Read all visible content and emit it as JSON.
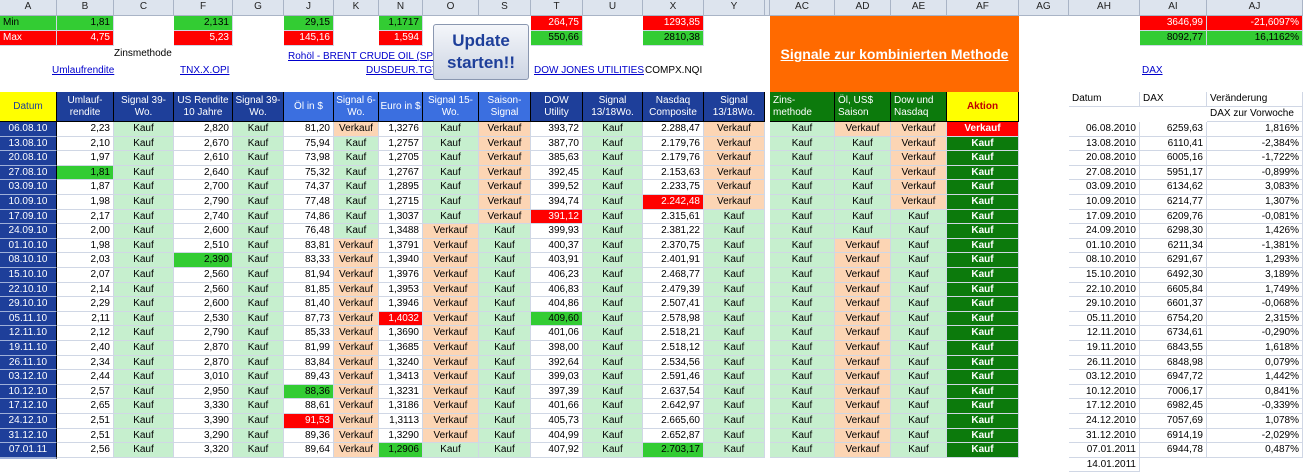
{
  "columns": [
    "A",
    "B",
    "C",
    "F",
    "G",
    "J",
    "K",
    "N",
    "O",
    "S",
    "T",
    "U",
    "X",
    "Y",
    "AC",
    "AD",
    "AE",
    "AF",
    "AG",
    "AH",
    "AI",
    "AJ"
  ],
  "top_stats": {
    "min_label": "Min",
    "max_label": "Max",
    "min": {
      "B": "1,81",
      "F": "2,131",
      "J": "29,15",
      "N": "1,1717",
      "T": "264,75",
      "X": "1293,85",
      "AI": "3646,99",
      "AJ": "-21,6097%"
    },
    "max": {
      "B": "4,75",
      "F": "5,23",
      "J": "145,16",
      "N": "1,594",
      "T": "550,66",
      "X": "2810,38",
      "AI": "8092,77",
      "AJ": "16,1162%"
    }
  },
  "labels": {
    "zinsmethode": "Zinsmethode",
    "umlaufrendite": "Umlaufrendite",
    "tnx": "TNX.X.OPI",
    "rohoel": "Rohöl - BRENT CRUDE OIL (SP",
    "dusdeur": "DUSDEUR.TGT",
    "dow": "DOW JONES UTILITIES",
    "compx": "COMPX.NQI",
    "dax": "DAX"
  },
  "update_button": "Update starten!!",
  "signal_banner": "Signale zur kombinierten Methode",
  "headers": {
    "datum": "Datum",
    "umlauf": "Umlauf- rendite",
    "sig39": "Signal 39-Wo.",
    "us": "US Rendite 10 Jahre",
    "sig39b": "Signal 39-Wo.",
    "oel": "Öl in $",
    "sig6": "Signal 6-Wo.",
    "euro": "Euro in $",
    "sig15": "Signal 15-Wo.",
    "saison": "Saison- Signal",
    "dowu": "DOW Utility",
    "sig1318": "Signal 13/18Wo.",
    "nasdaq": "Nasdaq Composite",
    "sig1318b": "Signal 13/18Wo.",
    "zins": "Zins- methode",
    "oelus": "Öl, US$ Saison",
    "downs": "Dow und Nasdaq",
    "aktion": "Aktion"
  },
  "right_headers": {
    "datum": "Datum",
    "dax": "DAX",
    "ver": "Veränderung",
    "ver2": "DAX zur Vorwoche"
  },
  "rows": [
    {
      "d": "06.08.10",
      "u": "2,23",
      "s1": "Kauf",
      "us": "2,820",
      "s2": "Kauf",
      "o": "81,20",
      "s3": "Verkauf",
      "e": "1,3276",
      "s4": "Kauf",
      "sa": "Verkauf",
      "dw": "393,72",
      "s5": "Kauf",
      "n": "2.288,47",
      "s6": "Verkauf",
      "z": "Kauf",
      "os": "Verkauf",
      "dn": "Verkauf",
      "a": "Verkauf",
      "rd": "06.08.2010",
      "dax": "6259,63",
      "ch": "1,816%"
    },
    {
      "d": "13.08.10",
      "u": "2,10",
      "s1": "Kauf",
      "us": "2,670",
      "s2": "Kauf",
      "o": "75,94",
      "s3": "Kauf",
      "e": "1,2757",
      "s4": "Kauf",
      "sa": "Verkauf",
      "dw": "387,70",
      "s5": "Kauf",
      "n": "2.179,76",
      "s6": "Verkauf",
      "z": "Kauf",
      "os": "Kauf",
      "dn": "Verkauf",
      "a": "Kauf",
      "rd": "13.08.2010",
      "dax": "6110,41",
      "ch": "-2,384%"
    },
    {
      "d": "20.08.10",
      "u": "1,97",
      "s1": "Kauf",
      "us": "2,610",
      "s2": "Kauf",
      "o": "73,98",
      "s3": "Kauf",
      "e": "1,2705",
      "s4": "Kauf",
      "sa": "Verkauf",
      "dw": "385,63",
      "s5": "Kauf",
      "n": "2.179,76",
      "s6": "Verkauf",
      "z": "Kauf",
      "os": "Kauf",
      "dn": "Verkauf",
      "a": "Kauf",
      "rd": "20.08.2010",
      "dax": "6005,16",
      "ch": "-1,722%"
    },
    {
      "d": "27.08.10",
      "u": "1,81",
      "s1": "Kauf",
      "us": "2,640",
      "s2": "Kauf",
      "o": "75,32",
      "s3": "Kauf",
      "e": "1,2767",
      "s4": "Kauf",
      "sa": "Verkauf",
      "dw": "392,45",
      "s5": "Kauf",
      "n": "2.153,63",
      "s6": "Verkauf",
      "z": "Kauf",
      "os": "Kauf",
      "dn": "Verkauf",
      "a": "Kauf",
      "rd": "27.08.2010",
      "dax": "5951,17",
      "ch": "-0,899%"
    },
    {
      "d": "03.09.10",
      "u": "1,87",
      "s1": "Kauf",
      "us": "2,700",
      "s2": "Kauf",
      "o": "74,37",
      "s3": "Kauf",
      "e": "1,2895",
      "s4": "Kauf",
      "sa": "Verkauf",
      "dw": "399,52",
      "s5": "Kauf",
      "n": "2.233,75",
      "s6": "Verkauf",
      "z": "Kauf",
      "os": "Kauf",
      "dn": "Verkauf",
      "a": "Kauf",
      "rd": "03.09.2010",
      "dax": "6134,62",
      "ch": "3,083%"
    },
    {
      "d": "10.09.10",
      "u": "1,98",
      "s1": "Kauf",
      "us": "2,790",
      "s2": "Kauf",
      "o": "77,48",
      "s3": "Kauf",
      "e": "1,2715",
      "s4": "Kauf",
      "sa": "Verkauf",
      "dw": "394,74",
      "s5": "Kauf",
      "n": "2.242,48",
      "s6": "Verkauf",
      "z": "Kauf",
      "os": "Kauf",
      "dn": "Verkauf",
      "a": "Kauf",
      "rd": "10.09.2010",
      "dax": "6214,77",
      "ch": "1,307%"
    },
    {
      "d": "17.09.10",
      "u": "2,17",
      "s1": "Kauf",
      "us": "2,740",
      "s2": "Kauf",
      "o": "74,86",
      "s3": "Kauf",
      "e": "1,3037",
      "s4": "Kauf",
      "sa": "Verkauf",
      "dw": "391,12",
      "s5": "Kauf",
      "n": "2.315,61",
      "s6": "Kauf",
      "z": "Kauf",
      "os": "Kauf",
      "dn": "Kauf",
      "a": "Kauf",
      "rd": "17.09.2010",
      "dax": "6209,76",
      "ch": "-0,081%"
    },
    {
      "d": "24.09.10",
      "u": "2,00",
      "s1": "Kauf",
      "us": "2,600",
      "s2": "Kauf",
      "o": "76,48",
      "s3": "Kauf",
      "e": "1,3488",
      "s4": "Verkauf",
      "sa": "Kauf",
      "dw": "399,93",
      "s5": "Kauf",
      "n": "2.381,22",
      "s6": "Kauf",
      "z": "Kauf",
      "os": "Kauf",
      "dn": "Kauf",
      "a": "Kauf",
      "rd": "24.09.2010",
      "dax": "6298,30",
      "ch": "1,426%"
    },
    {
      "d": "01.10.10",
      "u": "1,98",
      "s1": "Kauf",
      "us": "2,510",
      "s2": "Kauf",
      "o": "83,81",
      "s3": "Verkauf",
      "e": "1,3791",
      "s4": "Verkauf",
      "sa": "Kauf",
      "dw": "400,37",
      "s5": "Kauf",
      "n": "2.370,75",
      "s6": "Kauf",
      "z": "Kauf",
      "os": "Verkauf",
      "dn": "Kauf",
      "a": "Kauf",
      "rd": "01.10.2010",
      "dax": "6211,34",
      "ch": "-1,381%"
    },
    {
      "d": "08.10.10",
      "u": "2,03",
      "s1": "Kauf",
      "us": "2,390",
      "s2": "Kauf",
      "o": "83,33",
      "s3": "Verkauf",
      "e": "1,3940",
      "s4": "Verkauf",
      "sa": "Kauf",
      "dw": "403,91",
      "s5": "Kauf",
      "n": "2.401,91",
      "s6": "Kauf",
      "z": "Kauf",
      "os": "Verkauf",
      "dn": "Kauf",
      "a": "Kauf",
      "rd": "08.10.2010",
      "dax": "6291,67",
      "ch": "1,293%"
    },
    {
      "d": "15.10.10",
      "u": "2,07",
      "s1": "Kauf",
      "us": "2,560",
      "s2": "Kauf",
      "o": "81,94",
      "s3": "Verkauf",
      "e": "1,3976",
      "s4": "Verkauf",
      "sa": "Kauf",
      "dw": "406,23",
      "s5": "Kauf",
      "n": "2.468,77",
      "s6": "Kauf",
      "z": "Kauf",
      "os": "Verkauf",
      "dn": "Kauf",
      "a": "Kauf",
      "rd": "15.10.2010",
      "dax": "6492,30",
      "ch": "3,189%"
    },
    {
      "d": "22.10.10",
      "u": "2,14",
      "s1": "Kauf",
      "us": "2,560",
      "s2": "Kauf",
      "o": "81,85",
      "s3": "Verkauf",
      "e": "1,3953",
      "s4": "Verkauf",
      "sa": "Kauf",
      "dw": "406,83",
      "s5": "Kauf",
      "n": "2.479,39",
      "s6": "Kauf",
      "z": "Kauf",
      "os": "Verkauf",
      "dn": "Kauf",
      "a": "Kauf",
      "rd": "22.10.2010",
      "dax": "6605,84",
      "ch": "1,749%"
    },
    {
      "d": "29.10.10",
      "u": "2,29",
      "s1": "Kauf",
      "us": "2,600",
      "s2": "Kauf",
      "o": "81,40",
      "s3": "Verkauf",
      "e": "1,3946",
      "s4": "Verkauf",
      "sa": "Kauf",
      "dw": "404,86",
      "s5": "Kauf",
      "n": "2.507,41",
      "s6": "Kauf",
      "z": "Kauf",
      "os": "Verkauf",
      "dn": "Kauf",
      "a": "Kauf",
      "rd": "29.10.2010",
      "dax": "6601,37",
      "ch": "-0,068%"
    },
    {
      "d": "05.11.10",
      "u": "2,11",
      "s1": "Kauf",
      "us": "2,530",
      "s2": "Kauf",
      "o": "87,73",
      "s3": "Verkauf",
      "e": "1,4032",
      "s4": "Verkauf",
      "sa": "Kauf",
      "dw": "409,60",
      "s5": "Kauf",
      "n": "2.578,98",
      "s6": "Kauf",
      "z": "Kauf",
      "os": "Verkauf",
      "dn": "Kauf",
      "a": "Kauf",
      "rd": "05.11.2010",
      "dax": "6754,20",
      "ch": "2,315%"
    },
    {
      "d": "12.11.10",
      "u": "2,12",
      "s1": "Kauf",
      "us": "2,790",
      "s2": "Kauf",
      "o": "85,33",
      "s3": "Verkauf",
      "e": "1,3690",
      "s4": "Verkauf",
      "sa": "Kauf",
      "dw": "401,06",
      "s5": "Kauf",
      "n": "2.518,21",
      "s6": "Kauf",
      "z": "Kauf",
      "os": "Verkauf",
      "dn": "Kauf",
      "a": "Kauf",
      "rd": "12.11.2010",
      "dax": "6734,61",
      "ch": "-0,290%"
    },
    {
      "d": "19.11.10",
      "u": "2,40",
      "s1": "Kauf",
      "us": "2,870",
      "s2": "Kauf",
      "o": "81,99",
      "s3": "Verkauf",
      "e": "1,3685",
      "s4": "Verkauf",
      "sa": "Kauf",
      "dw": "398,00",
      "s5": "Kauf",
      "n": "2.518,12",
      "s6": "Kauf",
      "z": "Kauf",
      "os": "Verkauf",
      "dn": "Kauf",
      "a": "Kauf",
      "rd": "19.11.2010",
      "dax": "6843,55",
      "ch": "1,618%"
    },
    {
      "d": "26.11.10",
      "u": "2,34",
      "s1": "Kauf",
      "us": "2,870",
      "s2": "Kauf",
      "o": "83,84",
      "s3": "Verkauf",
      "e": "1,3240",
      "s4": "Verkauf",
      "sa": "Kauf",
      "dw": "392,64",
      "s5": "Kauf",
      "n": "2.534,56",
      "s6": "Kauf",
      "z": "Kauf",
      "os": "Verkauf",
      "dn": "Kauf",
      "a": "Kauf",
      "rd": "26.11.2010",
      "dax": "6848,98",
      "ch": "0,079%"
    },
    {
      "d": "03.12.10",
      "u": "2,44",
      "s1": "Kauf",
      "us": "3,010",
      "s2": "Kauf",
      "o": "89,43",
      "s3": "Verkauf",
      "e": "1,3413",
      "s4": "Verkauf",
      "sa": "Kauf",
      "dw": "399,03",
      "s5": "Kauf",
      "n": "2.591,46",
      "s6": "Kauf",
      "z": "Kauf",
      "os": "Verkauf",
      "dn": "Kauf",
      "a": "Kauf",
      "rd": "03.12.2010",
      "dax": "6947,72",
      "ch": "1,442%"
    },
    {
      "d": "10.12.10",
      "u": "2,57",
      "s1": "Kauf",
      "us": "2,950",
      "s2": "Kauf",
      "o": "88,36",
      "s3": "Verkauf",
      "e": "1,3231",
      "s4": "Verkauf",
      "sa": "Kauf",
      "dw": "397,39",
      "s5": "Kauf",
      "n": "2.637,54",
      "s6": "Kauf",
      "z": "Kauf",
      "os": "Verkauf",
      "dn": "Kauf",
      "a": "Kauf",
      "rd": "10.12.2010",
      "dax": "7006,17",
      "ch": "0,841%"
    },
    {
      "d": "17.12.10",
      "u": "2,65",
      "s1": "Kauf",
      "us": "3,330",
      "s2": "Kauf",
      "o": "88,61",
      "s3": "Verkauf",
      "e": "1,3186",
      "s4": "Verkauf",
      "sa": "Kauf",
      "dw": "401,66",
      "s5": "Kauf",
      "n": "2.642,97",
      "s6": "Kauf",
      "z": "Kauf",
      "os": "Verkauf",
      "dn": "Kauf",
      "a": "Kauf",
      "rd": "17.12.2010",
      "dax": "6982,45",
      "ch": "-0,339%"
    },
    {
      "d": "24.12.10",
      "u": "2,51",
      "s1": "Kauf",
      "us": "3,390",
      "s2": "Kauf",
      "o": "91,53",
      "s3": "Verkauf",
      "e": "1,3113",
      "s4": "Verkauf",
      "sa": "Kauf",
      "dw": "405,73",
      "s5": "Kauf",
      "n": "2.665,60",
      "s6": "Kauf",
      "z": "Kauf",
      "os": "Verkauf",
      "dn": "Kauf",
      "a": "Kauf",
      "rd": "24.12.2010",
      "dax": "7057,69",
      "ch": "1,078%"
    },
    {
      "d": "31.12.10",
      "u": "2,51",
      "s1": "Kauf",
      "us": "3,290",
      "s2": "Kauf",
      "o": "89,36",
      "s3": "Verkauf",
      "e": "1,3290",
      "s4": "Verkauf",
      "sa": "Kauf",
      "dw": "404,99",
      "s5": "Kauf",
      "n": "2.652,87",
      "s6": "Kauf",
      "z": "Kauf",
      "os": "Verkauf",
      "dn": "Kauf",
      "a": "Kauf",
      "rd": "31.12.2010",
      "dax": "6914,19",
      "ch": "-2,029%"
    },
    {
      "d": "07.01.11",
      "u": "2,56",
      "s1": "Kauf",
      "us": "3,320",
      "s2": "Kauf",
      "o": "89,64",
      "s3": "Verkauf",
      "e": "1,2906",
      "s4": "Kauf",
      "sa": "Kauf",
      "dw": "407,92",
      "s5": "Kauf",
      "n": "2.703,17",
      "s6": "Kauf",
      "z": "Kauf",
      "os": "Verkauf",
      "dn": "Kauf",
      "a": "Kauf",
      "rd": "07.01.2011",
      "dax": "6944,78",
      "ch": "0,487%"
    }
  ],
  "last_date": "14.01.2011",
  "highlights": {
    "green": [
      "3.u",
      "9.us",
      "13.dw",
      "18.o",
      "22.e",
      "22.n"
    ],
    "red": [
      "5.n",
      "6.dw",
      "13.e",
      "20.o"
    ]
  },
  "colors": {
    "header_blue": "#1e3f9a",
    "signal_green": "#0c7a0c",
    "kauf_bg": "#c6efce",
    "verkauf_bg": "#fcd5b4",
    "banner_orange": "#ff6a00",
    "aktion_yellow": "#ffff00"
  }
}
